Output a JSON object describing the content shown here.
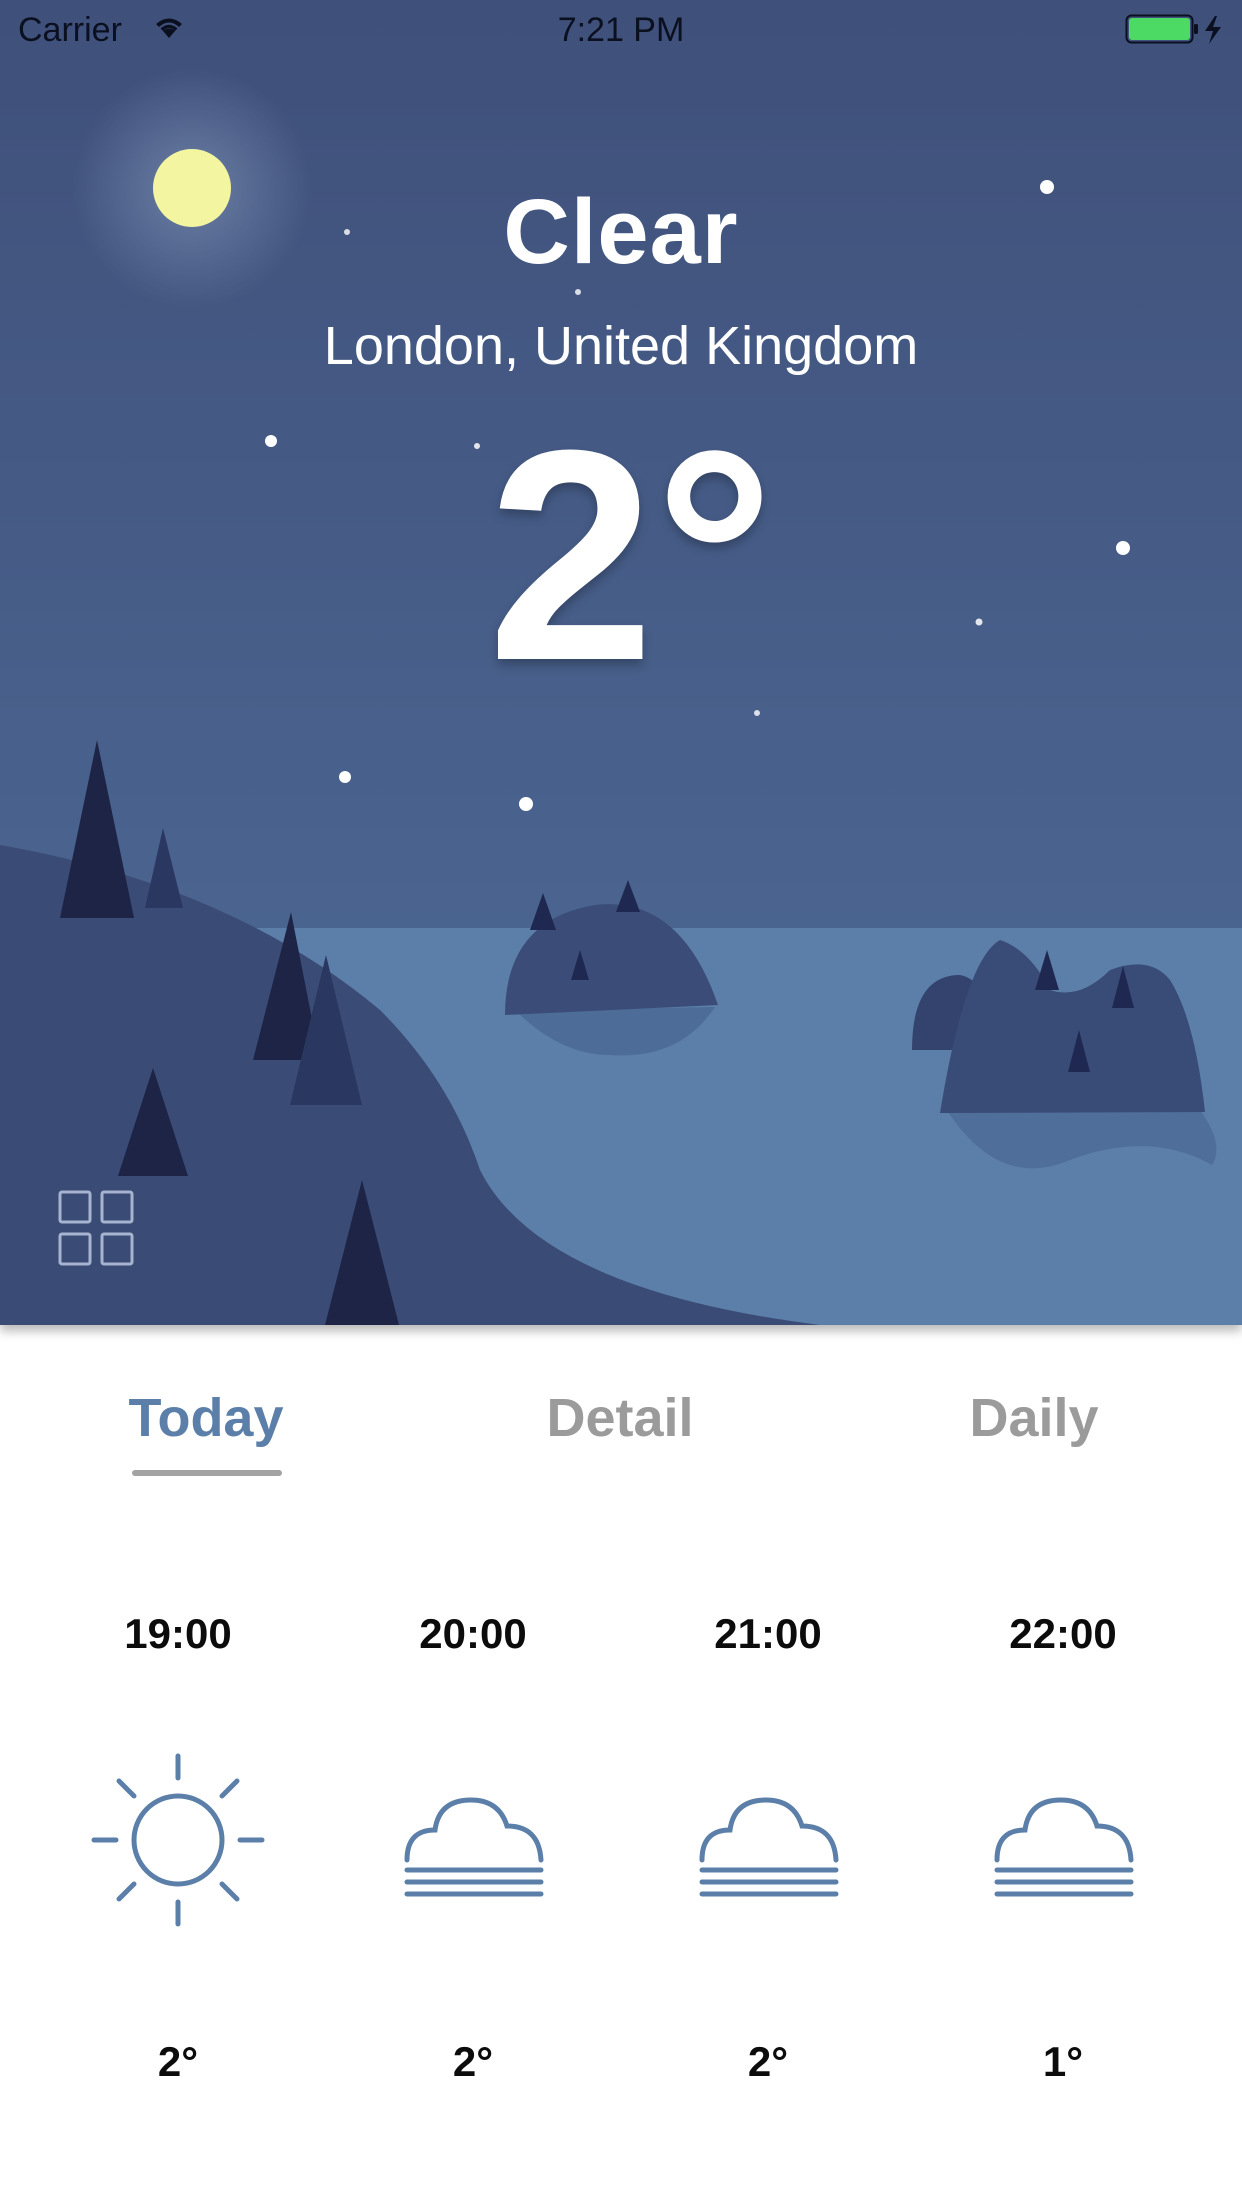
{
  "status_bar": {
    "carrier": "Carrier",
    "time": "7:21 PM",
    "battery_color": "#4cd964"
  },
  "weather": {
    "condition": "Clear",
    "location": "London, United Kingdom",
    "temperature": "2°"
  },
  "tabs": [
    {
      "label": "Today",
      "active": true
    },
    {
      "label": "Detail",
      "active": false
    },
    {
      "label": "Daily",
      "active": false
    }
  ],
  "hourly": [
    {
      "time": "19:00",
      "icon": "sun-icon",
      "temp": "2°"
    },
    {
      "time": "20:00",
      "icon": "fog-cloud-icon",
      "temp": "2°"
    },
    {
      "time": "21:00",
      "icon": "fog-cloud-icon",
      "temp": "2°"
    },
    {
      "time": "22:00",
      "icon": "fog-cloud-icon",
      "temp": "1°"
    }
  ],
  "colors": {
    "sky_top": "#3e5079",
    "sky_bottom": "#4c6a97",
    "water": "#5b7fa8",
    "hill": "#3a4b76",
    "tree": "#1d2445",
    "moon": "#f3f5a0",
    "accent": "#5b7fa8",
    "inactive_tab": "#9b9b9b"
  }
}
